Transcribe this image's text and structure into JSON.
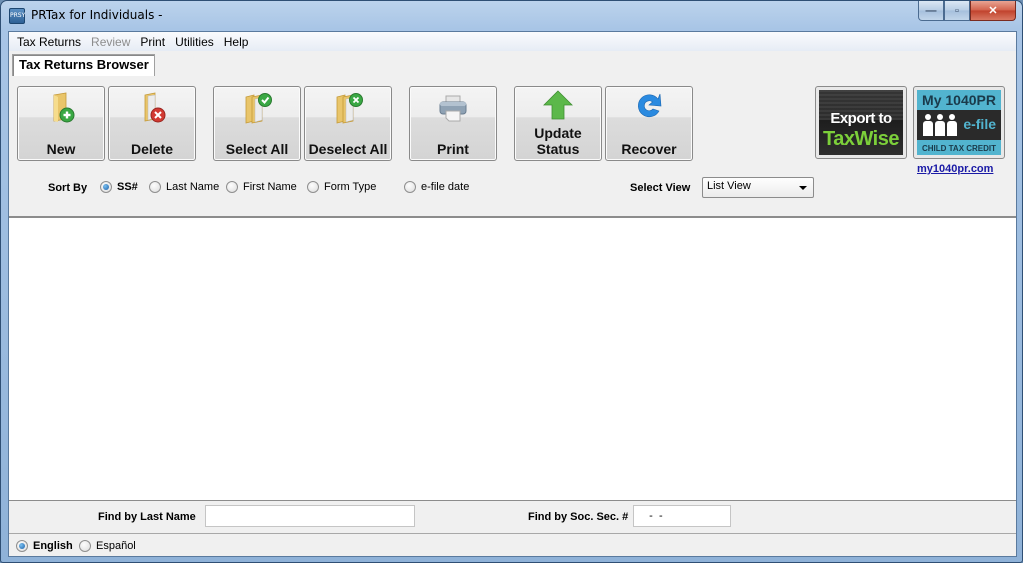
{
  "window": {
    "title": "PRTax for Individuals -",
    "app_icon_text": "PRSY",
    "controls": {
      "minimize": "—",
      "maximize": "▫",
      "close": "✕"
    }
  },
  "menu": [
    {
      "label": "Tax Returns",
      "enabled": true
    },
    {
      "label": "Review",
      "enabled": false
    },
    {
      "label": "Print",
      "enabled": true
    },
    {
      "label": "Utilities",
      "enabled": true
    },
    {
      "label": "Help",
      "enabled": true
    }
  ],
  "tab": {
    "label": "Tax Returns Browser"
  },
  "toolbar": {
    "new": "New",
    "delete": "Delete",
    "select_all": "Select All",
    "deselect_all": "Deselect All",
    "print": "Print",
    "update_status": "Update Status",
    "recover": "Recover"
  },
  "promos": {
    "taxwise": {
      "line1": "Export to",
      "line2": "TaxWise"
    },
    "my1040pr": {
      "title": "My 1040PR",
      "efile": "e-file",
      "subtitle": "CHILD TAX CREDIT"
    },
    "link": "my1040pr.com"
  },
  "sort": {
    "label": "Sort By",
    "options": [
      "SS#",
      "Last Name",
      "First Name",
      "Form Type",
      "e-file date"
    ],
    "selected": "SS#"
  },
  "view": {
    "label": "Select View",
    "selected": "List View"
  },
  "find": {
    "last_name_label": "Find by Last Name",
    "last_name_value": "",
    "ssn_label": "Find by Soc. Sec. #",
    "ssn_value": "   -  -"
  },
  "language": {
    "options": [
      "English",
      "Español"
    ],
    "selected": "English"
  },
  "colors": {
    "taxwise_green": "#7ccf3a",
    "my1040pr_blue": "#52b4cf",
    "link_blue": "#1a1aa6",
    "radio_selected": "#1b5fa8"
  }
}
